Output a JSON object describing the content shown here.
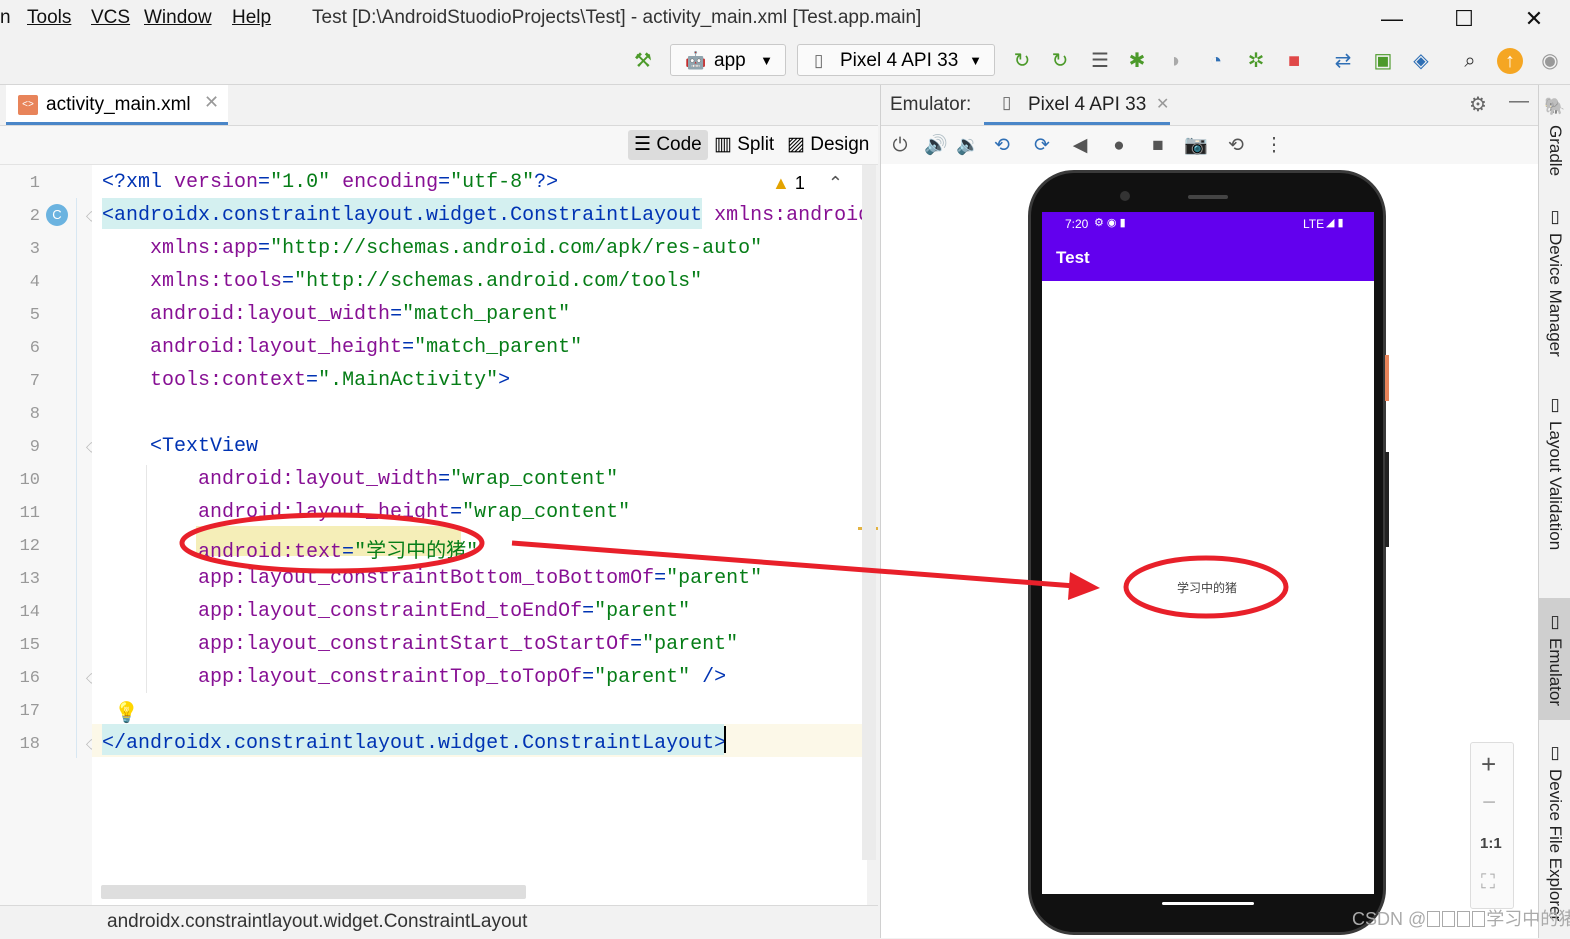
{
  "menubar": {
    "items": [
      "n",
      "Tools",
      "VCS",
      "Window",
      "Help"
    ],
    "title": "Test [D:\\AndroidStuodioProjects\\Test] - activity_main.xml [Test.app.main]",
    "minimize": "—",
    "maximize": "☐",
    "close": "✕"
  },
  "toolbar": {
    "run_config": "app",
    "device": "Pixel 4 API 33"
  },
  "editor": {
    "tab_label": "activity_main.xml",
    "view_modes": [
      "Code",
      "Split",
      "Design"
    ],
    "warning_count": "1",
    "lines": [
      {
        "n": "1",
        "parts": [
          [
            "tag",
            "<?"
          ],
          [
            "tag",
            "xml "
          ],
          [
            "attr",
            "version"
          ],
          [
            "tag",
            "="
          ],
          [
            "val",
            "\"1.0\""
          ],
          [
            "tag",
            " "
          ],
          [
            "attr",
            "encoding"
          ],
          [
            "tag",
            "="
          ],
          [
            "val",
            "\"utf-8\""
          ],
          [
            "tag",
            "?>"
          ]
        ]
      },
      {
        "n": "2",
        "parts": [
          [
            "tag",
            "<androidx.constraintlayout.widget.ConstraintLayout "
          ],
          [
            "attr",
            "xmlns:android="
          ]
        ]
      },
      {
        "n": "3",
        "parts": [
          [
            "tag",
            "    "
          ],
          [
            "attr",
            "xmlns:app"
          ],
          [
            "tag",
            "="
          ],
          [
            "val",
            "\"http://schemas.android.com/apk/res-auto\""
          ]
        ]
      },
      {
        "n": "4",
        "parts": [
          [
            "tag",
            "    "
          ],
          [
            "attr",
            "xmlns:tools"
          ],
          [
            "tag",
            "="
          ],
          [
            "val",
            "\"http://schemas.android.com/tools\""
          ]
        ]
      },
      {
        "n": "5",
        "parts": [
          [
            "tag",
            "    "
          ],
          [
            "attr",
            "android:layout_width"
          ],
          [
            "tag",
            "="
          ],
          [
            "val",
            "\"match_parent\""
          ]
        ]
      },
      {
        "n": "6",
        "parts": [
          [
            "tag",
            "    "
          ],
          [
            "attr",
            "android:layout_height"
          ],
          [
            "tag",
            "="
          ],
          [
            "val",
            "\"match_parent\""
          ]
        ]
      },
      {
        "n": "7",
        "parts": [
          [
            "tag",
            "    "
          ],
          [
            "attr",
            "tools:context"
          ],
          [
            "tag",
            "="
          ],
          [
            "val",
            "\".MainActivity\""
          ],
          [
            "tag",
            ">"
          ]
        ]
      },
      {
        "n": "8",
        "parts": []
      },
      {
        "n": "9",
        "parts": [
          [
            "tag",
            "    <TextView"
          ]
        ]
      },
      {
        "n": "10",
        "parts": [
          [
            "tag",
            "        "
          ],
          [
            "attr",
            "android:layout_width"
          ],
          [
            "tag",
            "="
          ],
          [
            "val",
            "\"wrap_content\""
          ]
        ]
      },
      {
        "n": "11",
        "parts": [
          [
            "tag",
            "        "
          ],
          [
            "attr",
            "android:layout_height"
          ],
          [
            "tag",
            "="
          ],
          [
            "val",
            "\"wrap_content\""
          ]
        ]
      },
      {
        "n": "12",
        "parts": [
          [
            "tag",
            "        "
          ],
          [
            "attr",
            "android:text"
          ],
          [
            "tag",
            "="
          ],
          [
            "val",
            "\"学习中的猪\""
          ]
        ]
      },
      {
        "n": "13",
        "parts": [
          [
            "tag",
            "        "
          ],
          [
            "attr",
            "app:layout_constraintBottom_toBottomOf"
          ],
          [
            "tag",
            "="
          ],
          [
            "val",
            "\"parent\""
          ]
        ]
      },
      {
        "n": "14",
        "parts": [
          [
            "tag",
            "        "
          ],
          [
            "attr",
            "app:layout_constraintEnd_toEndOf"
          ],
          [
            "tag",
            "="
          ],
          [
            "val",
            "\"parent\""
          ]
        ]
      },
      {
        "n": "15",
        "parts": [
          [
            "tag",
            "        "
          ],
          [
            "attr",
            "app:layout_constraintStart_toStartOf"
          ],
          [
            "tag",
            "="
          ],
          [
            "val",
            "\"parent\""
          ]
        ]
      },
      {
        "n": "16",
        "parts": [
          [
            "tag",
            "        "
          ],
          [
            "attr",
            "app:layout_constraintTop_toTopOf"
          ],
          [
            "tag",
            "="
          ],
          [
            "val",
            "\"parent\""
          ],
          [
            "tag",
            " />"
          ]
        ]
      },
      {
        "n": "17",
        "parts": []
      },
      {
        "n": "18",
        "parts": [
          [
            "tag",
            "</androidx.constraintlayout.widget.ConstraintLayout>"
          ]
        ]
      }
    ],
    "breadcrumb": "androidx.constraintlayout.widget.ConstraintLayout"
  },
  "emulator": {
    "label": "Emulator:",
    "tab_label": "Pixel 4 API 33",
    "phone": {
      "time": "7:20",
      "network": "LTE",
      "app_title": "Test",
      "text_view": "学习中的猪"
    },
    "zoom": {
      "plus": "+",
      "minus": "−",
      "one_to_one": "1:1"
    }
  },
  "right_strip": [
    "Gradle",
    "Device Manager",
    "Layout Validation",
    "Emulator",
    "Device File Explorer"
  ],
  "watermark": {
    "prefix": "CSDN @",
    "suffix": "学习中的猪"
  },
  "colors": {
    "accent": "#6200ee",
    "annotation": "#e8202a",
    "tab_underline": "#4a86c8"
  }
}
